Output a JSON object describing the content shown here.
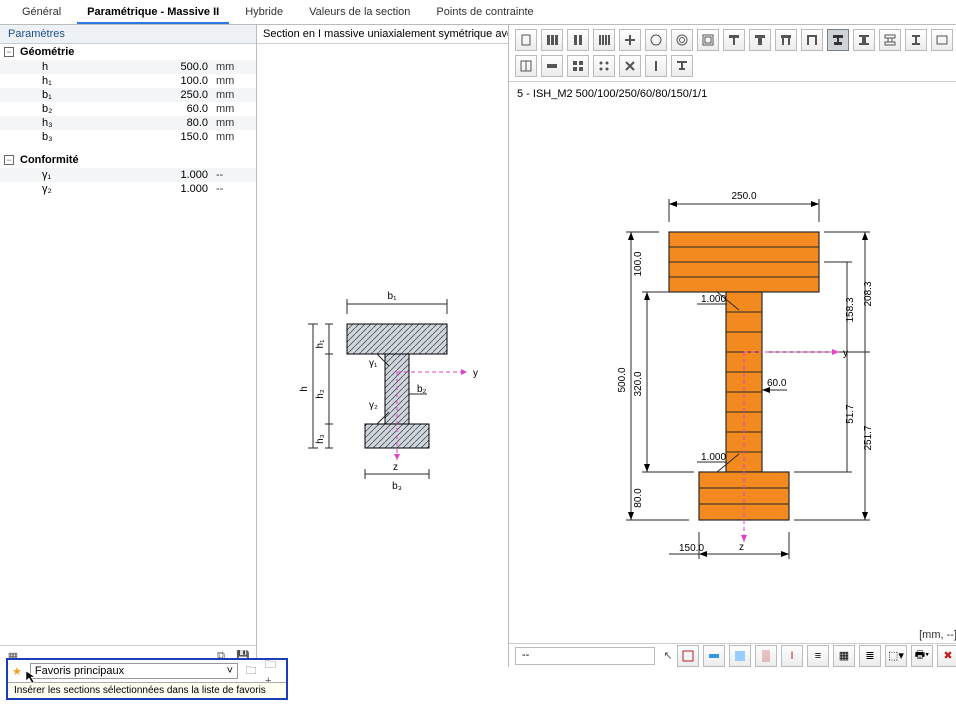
{
  "tabs": {
    "general": "Général",
    "parametric": "Paramétrique - Massive II",
    "hybrid": "Hybride",
    "section_values": "Valeurs de la section",
    "stress_points": "Points de contrainte"
  },
  "left_panel": {
    "title": "Paramètres",
    "geometry_label": "Géométrie",
    "conformity_label": "Conformité",
    "geometry": [
      {
        "name": "h",
        "value": "500.0",
        "unit": "mm"
      },
      {
        "name": "h₁",
        "value": "100.0",
        "unit": "mm"
      },
      {
        "name": "b₁",
        "value": "250.0",
        "unit": "mm"
      },
      {
        "name": "b₂",
        "value": "60.0",
        "unit": "mm"
      },
      {
        "name": "h₃",
        "value": "80.0",
        "unit": "mm"
      },
      {
        "name": "b₃",
        "value": "150.0",
        "unit": "mm"
      }
    ],
    "conformity": [
      {
        "name": "γ₁",
        "value": "1.000",
        "unit": "--"
      },
      {
        "name": "γ₂",
        "value": "1.000",
        "unit": "--"
      }
    ]
  },
  "middle_panel": {
    "title": "Section en I massive uniaxialement symétrique avec lignes",
    "labels": {
      "b1": "b₁",
      "b2": "b₂",
      "b3": "b₃",
      "h": "h",
      "h1": "h₁",
      "h2": "h₂",
      "h3": "h₃",
      "g1": "γ₁",
      "g2": "γ₂",
      "y": "y",
      "z": "z"
    }
  },
  "right_panel": {
    "section_name": "5 - ISH_M2 500/100/250/60/80/150/1/1",
    "dims": {
      "top_width": "250.0",
      "bottom_width": "150.0",
      "total_h": "500.0",
      "inner_h": "320.0",
      "top_h": "100.0",
      "bot_h": "80.0",
      "g1": "1.000",
      "g2": "1.000",
      "btw": "60.0",
      "r1": "208.3",
      "r2": "158.3",
      "r3": "51.7",
      "r4": "251.7",
      "y": "y",
      "z": "z"
    },
    "units_footer": "[mm, --]",
    "status_left": "--"
  },
  "favorites": {
    "dropdown_label": "Favoris principaux",
    "tooltip": "Insérer les sections sélectionnées dans la liste de favoris"
  }
}
